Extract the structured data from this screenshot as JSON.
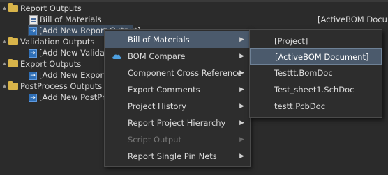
{
  "tree": {
    "report_outputs": "Report Outputs",
    "bill_of_materials": "Bill of Materials",
    "bom_value": "[ActiveBOM Docu",
    "add_new_report": "[Add New Report Output]",
    "validation_outputs": "Validation Outputs",
    "add_new_validation": "[Add New Validati",
    "export_outputs": "Export Outputs",
    "add_new_export": "[Add New Export O",
    "postprocess_outputs": "PostProcess Outputs",
    "add_new_postprocess": "[Add New PostPro"
  },
  "context_menu": {
    "items": [
      {
        "label": "Bill of Materials",
        "has_submenu": true,
        "highlighted": true
      },
      {
        "label": "BOM Compare",
        "has_submenu": true,
        "icon": "cloud-icon"
      },
      {
        "label": "Component Cross Reference",
        "has_submenu": true
      },
      {
        "label": "Export Comments",
        "has_submenu": true
      },
      {
        "label": "Project History",
        "has_submenu": true
      },
      {
        "label": "Report Project Hierarchy",
        "has_submenu": true
      },
      {
        "label": "Script Output",
        "has_submenu": true,
        "disabled": true
      },
      {
        "label": "Report Single Pin Nets",
        "has_submenu": true
      }
    ]
  },
  "submenu": {
    "items": [
      {
        "label": "[Project]"
      },
      {
        "label": "[ActiveBOM Document]",
        "highlighted": true
      },
      {
        "label": "Testtt.BomDoc"
      },
      {
        "label": "Test_sheet1.SchDoc"
      },
      {
        "label": "testt.PcbDoc"
      }
    ]
  },
  "colors": {
    "background": "#2b2b2b",
    "menu_highlight": "#4b5a6c",
    "folder": "#d8b44a",
    "add_icon": "#2f6fb6"
  }
}
